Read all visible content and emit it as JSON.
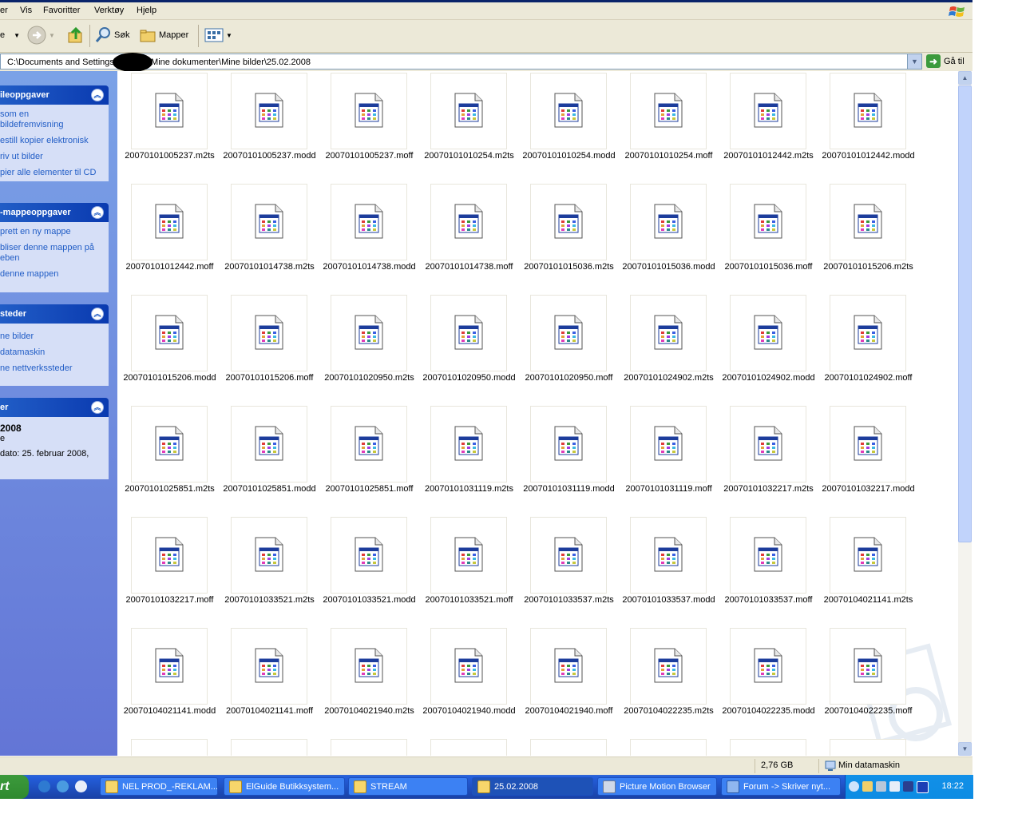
{
  "menubar": {
    "items": [
      "er",
      "Vis",
      "Favoritter",
      "Verktøy",
      "Hjelp"
    ]
  },
  "toolbar": {
    "back_label": "e",
    "search_label": "Søk",
    "folders_label": "Mapper"
  },
  "address": {
    "path_prefix": "C:\\Documents and Settings\\",
    "path_suffix": "\\Mine dokumenter\\Mine bilder\\25.02.2008",
    "go_label": "Gå til"
  },
  "leftpane": {
    "panels": [
      {
        "title": "ileoppgaver",
        "items": [
          "som en",
          "bildefremvisning",
          "estill kopier elektronisk",
          "riv ut bilder",
          "pier alle elementer til CD"
        ]
      },
      {
        "title": "-mappeoppgaver",
        "items": [
          "prett en ny mappe",
          "bliser denne mappen på",
          "eben",
          "denne mappen"
        ]
      },
      {
        "title": "steder",
        "items": [
          "ne bilder",
          "datamaskin",
          "ne nettverkssteder"
        ]
      },
      {
        "title": "er",
        "detail_title": "2008",
        "detail_sub": "e",
        "detail_date": "dato: 25. februar 2008,"
      }
    ]
  },
  "files": [
    "20070101005237.m2ts",
    "20070101005237.modd",
    "20070101005237.moff",
    "20070101010254.m2ts",
    "20070101010254.modd",
    "20070101010254.moff",
    "20070101012442.m2ts",
    "20070101012442.modd",
    "20070101012442.moff",
    "20070101014738.m2ts",
    "20070101014738.modd",
    "20070101014738.moff",
    "20070101015036.m2ts",
    "20070101015036.modd",
    "20070101015036.moff",
    "20070101015206.m2ts",
    "20070101015206.modd",
    "20070101015206.moff",
    "20070101020950.m2ts",
    "20070101020950.modd",
    "20070101020950.moff",
    "20070101024902.m2ts",
    "20070101024902.modd",
    "20070101024902.moff",
    "20070101025851.m2ts",
    "20070101025851.modd",
    "20070101025851.moff",
    "20070101031119.m2ts",
    "20070101031119.modd",
    "20070101031119.moff",
    "20070101032217.m2ts",
    "20070101032217.modd",
    "20070101032217.moff",
    "20070101033521.m2ts",
    "20070101033521.modd",
    "20070101033521.moff",
    "20070101033537.m2ts",
    "20070101033537.modd",
    "20070101033537.moff",
    "20070104021141.m2ts",
    "20070104021141.modd",
    "20070104021141.moff",
    "20070104021940.m2ts",
    "20070104021940.modd",
    "20070104021940.moff",
    "20070104022235.m2ts",
    "20070104022235.modd",
    "20070104022235.moff",
    "",
    "",
    "",
    "",
    "",
    "",
    "",
    ""
  ],
  "statusbar": {
    "size": "2,76 GB",
    "location": "Min datamaskin"
  },
  "taskbar": {
    "start_label": "rt",
    "buttons": [
      {
        "label": "NEL PROD_-REKLAM...",
        "active": false
      },
      {
        "label": "ElGuide Butikksystem...",
        "active": false
      },
      {
        "label": "STREAM",
        "active": false
      },
      {
        "label": "25.02.2008",
        "active": true
      },
      {
        "label": "Picture Motion Browser",
        "active": false
      },
      {
        "label": "Forum -> Skriver nyt...",
        "active": false
      }
    ],
    "clock": "18:22"
  }
}
